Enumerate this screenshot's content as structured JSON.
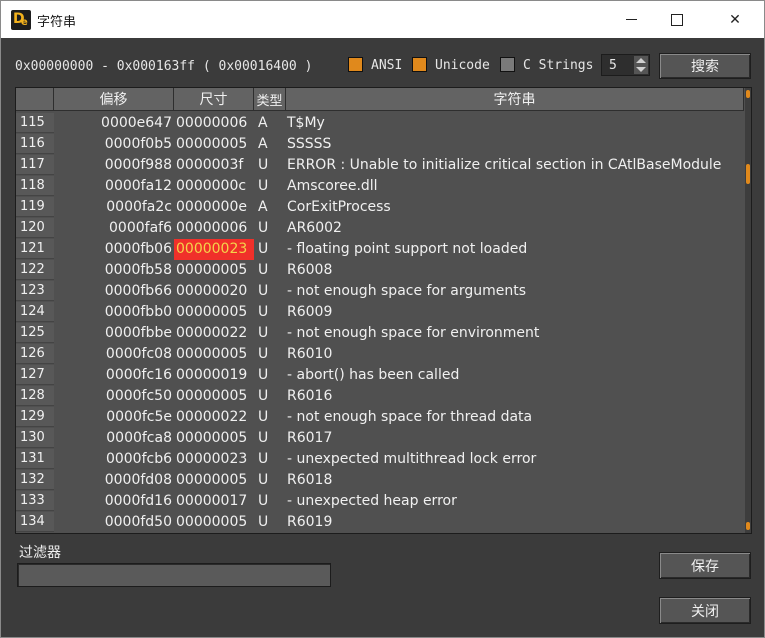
{
  "window": {
    "title": "字符串"
  },
  "range_label": "0x00000000 - 0x000163ff ( 0x00016400 )",
  "options": {
    "ansi": {
      "label": "ANSI",
      "checked": true
    },
    "unicode": {
      "label": "Unicode",
      "checked": true
    },
    "cstrings": {
      "label": "C Strings",
      "checked": false
    },
    "min_length": "5"
  },
  "buttons": {
    "search": "搜索",
    "save": "保存",
    "close": "关闭"
  },
  "table": {
    "columns": [
      "",
      "偏移",
      "尺寸",
      "类型",
      "字符串"
    ],
    "selected_row": 6,
    "rows": [
      {
        "n": "115",
        "offset": "0000e647",
        "size": "00000006",
        "type": "A",
        "text": "T$My"
      },
      {
        "n": "116",
        "offset": "0000f0b5",
        "size": "00000005",
        "type": "A",
        "text": "SSSSS"
      },
      {
        "n": "117",
        "offset": "0000f988",
        "size": "0000003f",
        "type": "U",
        "text": "ERROR : Unable to initialize critical section in CAtlBaseModule"
      },
      {
        "n": "118",
        "offset": "0000fa12",
        "size": "0000000c",
        "type": "U",
        "text": "Amscoree.dll"
      },
      {
        "n": "119",
        "offset": "0000fa2c",
        "size": "0000000e",
        "type": "A",
        "text": "CorExitProcess"
      },
      {
        "n": "120",
        "offset": "0000faf6",
        "size": "00000006",
        "type": "U",
        "text": "AR6002"
      },
      {
        "n": "121",
        "offset": "0000fb06",
        "size": "00000023",
        "type": "U",
        "text": "- floating point support not loaded"
      },
      {
        "n": "122",
        "offset": "0000fb58",
        "size": "00000005",
        "type": "U",
        "text": "R6008"
      },
      {
        "n": "123",
        "offset": "0000fb66",
        "size": "00000020",
        "type": "U",
        "text": "- not enough space for arguments"
      },
      {
        "n": "124",
        "offset": "0000fbb0",
        "size": "00000005",
        "type": "U",
        "text": "R6009"
      },
      {
        "n": "125",
        "offset": "0000fbbe",
        "size": "00000022",
        "type": "U",
        "text": "- not enough space for environment"
      },
      {
        "n": "126",
        "offset": "0000fc08",
        "size": "00000005",
        "type": "U",
        "text": "R6010"
      },
      {
        "n": "127",
        "offset": "0000fc16",
        "size": "00000019",
        "type": "U",
        "text": "- abort() has been called"
      },
      {
        "n": "128",
        "offset": "0000fc50",
        "size": "00000005",
        "type": "U",
        "text": "R6016"
      },
      {
        "n": "129",
        "offset": "0000fc5e",
        "size": "00000022",
        "type": "U",
        "text": "- not enough space for thread data"
      },
      {
        "n": "130",
        "offset": "0000fca8",
        "size": "00000005",
        "type": "U",
        "text": "R6017"
      },
      {
        "n": "131",
        "offset": "0000fcb6",
        "size": "00000023",
        "type": "U",
        "text": "- unexpected multithread lock error"
      },
      {
        "n": "132",
        "offset": "0000fd08",
        "size": "00000005",
        "type": "U",
        "text": "R6018"
      },
      {
        "n": "133",
        "offset": "0000fd16",
        "size": "00000017",
        "type": "U",
        "text": "- unexpected heap error"
      },
      {
        "n": "134",
        "offset": "0000fd50",
        "size": "00000005",
        "type": "U",
        "text": "R6019"
      }
    ]
  },
  "filter": {
    "label": "过滤器",
    "value": ""
  },
  "colors": {
    "accent": "#e0891c",
    "selection": "#f0302a",
    "selection_text": "#f4d34a"
  }
}
